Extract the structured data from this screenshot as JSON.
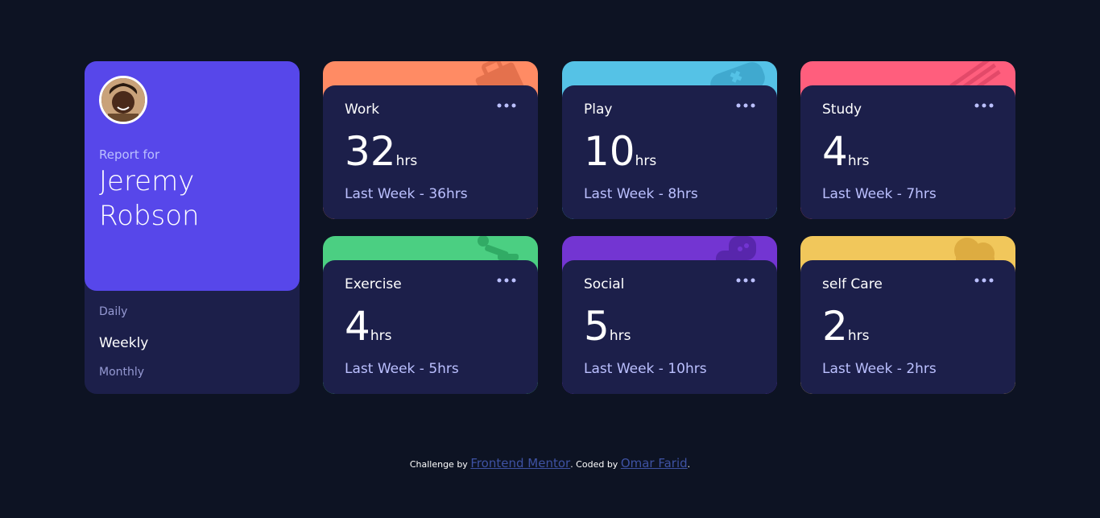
{
  "profile": {
    "report_for": "Report for",
    "name": "Jeremy Robson",
    "periods": [
      "Daily",
      "Weekly",
      "Monthly"
    ],
    "active_period": "Weekly"
  },
  "activities": [
    {
      "title": "Work",
      "current": "32",
      "unit": "hrs",
      "previous": "Last Week - 36hrs",
      "color": "#ff8b64",
      "icon": "briefcase-icon"
    },
    {
      "title": "Play",
      "current": "10",
      "unit": "hrs",
      "previous": "Last Week - 8hrs",
      "color": "#55c2e6",
      "icon": "gamepad-icon"
    },
    {
      "title": "Study",
      "current": "4",
      "unit": "hrs",
      "previous": "Last Week - 7hrs",
      "color": "#ff5e7d",
      "icon": "book-icon"
    },
    {
      "title": "Exercise",
      "current": "4",
      "unit": "hrs",
      "previous": "Last Week - 5hrs",
      "color": "#4bcf82",
      "icon": "runner-icon"
    },
    {
      "title": "Social",
      "current": "5",
      "unit": "hrs",
      "previous": "Last Week - 10hrs",
      "color": "#7335d2",
      "icon": "chat-icon"
    },
    {
      "title": "self Care",
      "current": "2",
      "unit": "hrs",
      "previous": "Last Week - 2hrs",
      "color": "#f1c75b",
      "icon": "heart-icon"
    }
  ],
  "footer": {
    "challenge_by": "Challenge by",
    "frontend_mentor": "Frontend Mentor",
    "coded_by": ". Coded by",
    "author": "Omar Farid",
    "end": "."
  }
}
